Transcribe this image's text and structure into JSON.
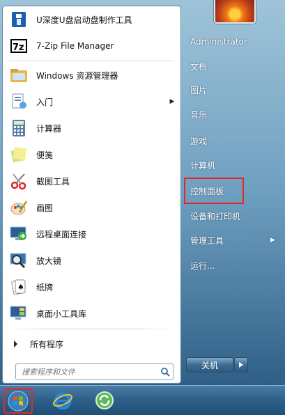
{
  "left_items": [
    {
      "label": "U深度U盘启动盘制作工具",
      "icon": "usb-drive-icon",
      "arrow": false
    },
    {
      "label": "7-Zip File Manager",
      "icon": "7zip-icon",
      "arrow": false
    },
    {
      "label": "Windows 资源管理器",
      "icon": "folder-explorer-icon",
      "arrow": false
    },
    {
      "label": "入门",
      "icon": "getting-started-icon",
      "arrow": true
    },
    {
      "label": "计算器",
      "icon": "calculator-icon",
      "arrow": false
    },
    {
      "label": "便笺",
      "icon": "sticky-notes-icon",
      "arrow": false
    },
    {
      "label": "截图工具",
      "icon": "scissors-icon",
      "arrow": false
    },
    {
      "label": "画图",
      "icon": "paint-icon",
      "arrow": false
    },
    {
      "label": "远程桌面连接",
      "icon": "remote-desktop-icon",
      "arrow": false
    },
    {
      "label": "放大镜",
      "icon": "magnifier-icon",
      "arrow": false
    },
    {
      "label": "纸牌",
      "icon": "cards-icon",
      "arrow": false
    },
    {
      "label": "桌面小工具库",
      "icon": "gadgets-icon",
      "arrow": false
    }
  ],
  "all_programs": "所有程序",
  "search": {
    "placeholder": "搜索程序和文件"
  },
  "right_items": [
    {
      "label": "Administrator"
    },
    {
      "label": "文档"
    },
    {
      "label": "图片"
    },
    {
      "label": "音乐"
    },
    {
      "label": "游戏"
    },
    {
      "label": "计算机"
    },
    {
      "label": "控制面板"
    },
    {
      "label": "设备和打印机"
    },
    {
      "label": "管理工具",
      "arrow": true
    },
    {
      "label": "运行..."
    }
  ],
  "shutdown_label": "关机",
  "highlight_color": "#e02a2a",
  "taskbar": [
    {
      "icon": "windows-start-icon"
    },
    {
      "icon": "internet-explorer-icon"
    },
    {
      "icon": "green-refresh-icon"
    }
  ]
}
